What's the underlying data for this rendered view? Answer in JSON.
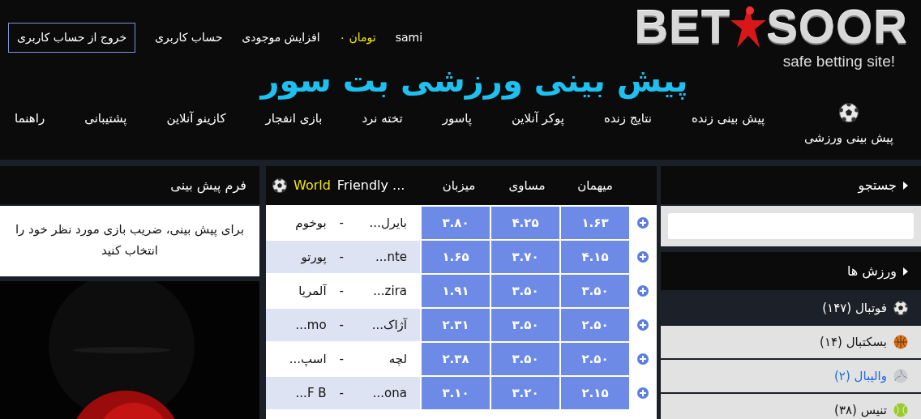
{
  "logo": {
    "left": "BET",
    "right": "SOOR",
    "tagline": "safe betting site!"
  },
  "user_bar": {
    "username": "sami",
    "balance": "تومان ۰",
    "links": [
      "افزایش موجودی",
      "حساب کاربری"
    ],
    "logout": "خروج از حساب کاربری"
  },
  "headline": "پیش بینی ورزشی بت سور",
  "nav": [
    {
      "label": "پیش بینی ورزشی",
      "kind": "featured"
    },
    {
      "label": "پیش بینی زنده",
      "kind": "plain"
    },
    {
      "label": "نتایج زنده",
      "kind": "plain"
    },
    {
      "label": "پوکر آنلاین",
      "kind": "plain"
    },
    {
      "label": "پاسور",
      "kind": "plain"
    },
    {
      "label": "تخته نرد",
      "kind": "plain"
    },
    {
      "label": "بازی انفجار",
      "kind": "plain"
    },
    {
      "label": "کازینو آنلاین",
      "kind": "plain"
    },
    {
      "label": "پشتیبانی",
      "kind": "plain"
    },
    {
      "label": "راهنما",
      "kind": "plain"
    }
  ],
  "search": {
    "title": "جستجو"
  },
  "sports": {
    "title": "ورزش ها",
    "items": [
      {
        "label": "فوتبال (۱۴۷)",
        "kind": "soccer",
        "selected": true,
        "hovered": false
      },
      {
        "label": "بسکتبال (۱۴)",
        "kind": "basketball",
        "selected": false,
        "hovered": false
      },
      {
        "label": "والیبال (۲)",
        "kind": "volleyball",
        "selected": false,
        "hovered": true
      },
      {
        "label": "تنیس (۳۸)",
        "kind": "tennis",
        "selected": false,
        "hovered": false
      }
    ]
  },
  "odds_table": {
    "league_region": "World",
    "league_name": "Friendly ...",
    "columns": [
      "میهمان",
      "مساوی",
      "میزبان"
    ],
    "rows": [
      {
        "teams": [
          "بایرل...",
          "بوخوم"
        ],
        "separator": "-",
        "odds": [
          "۱.۶۳",
          "۴.۲۵",
          "۳.۸۰"
        ]
      },
      {
        "teams": [
          "...nte",
          "پورتو"
        ],
        "separator": "-",
        "odds": [
          "۴.۱۵",
          "۳.۷۰",
          "۱.۶۵"
        ]
      },
      {
        "teams": [
          "...zira",
          "آلمریا"
        ],
        "separator": "-",
        "odds": [
          "۳.۵۰",
          "۳.۵۰",
          "۱.۹۱"
        ]
      },
      {
        "teams": [
          "آژاک...",
          "...mo"
        ],
        "separator": "-",
        "odds": [
          "۲.۵۰",
          "۳.۵۰",
          "۲.۳۱"
        ]
      },
      {
        "teams": [
          "لچه",
          "اسپ..."
        ],
        "separator": "-",
        "odds": [
          "۲.۵۰",
          "۳.۵۰",
          "۲.۳۸"
        ]
      },
      {
        "teams": [
          "...ona",
          "...F B"
        ],
        "separator": "-",
        "odds": [
          "۲.۱۵",
          "۳.۲۰",
          "۳.۱۰"
        ]
      }
    ]
  },
  "bet_slip": {
    "title": "فرم پیش بینی",
    "message": "برای پیش بینی، ضریب بازی مورد نظر خود را انتخاب کنید"
  }
}
